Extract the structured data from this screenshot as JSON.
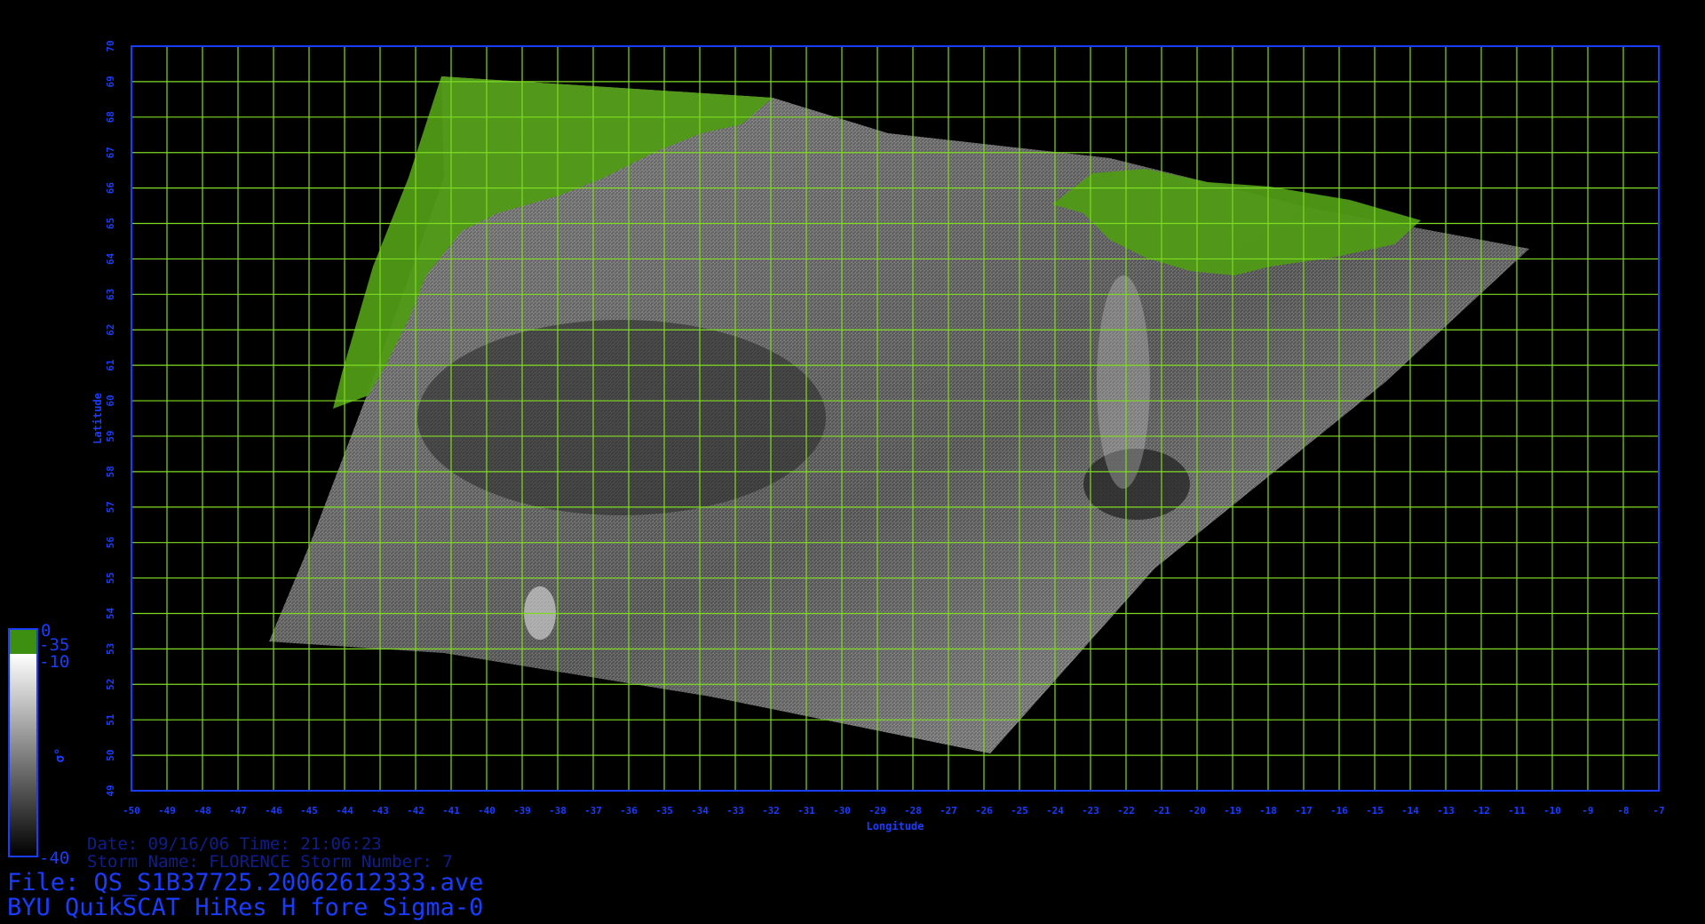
{
  "map": {
    "x_label": "Longitude",
    "y_label": "Latitude",
    "lon_range": [
      -50,
      -7
    ],
    "lat_range": [
      49,
      70
    ],
    "lon_ticks": [
      "-50",
      "-49",
      "-48",
      "-47",
      "-46",
      "-45",
      "-44",
      "-43",
      "-42",
      "-41",
      "-40",
      "-39",
      "-38",
      "-37",
      "-36",
      "-35",
      "-34",
      "-33",
      "-32",
      "-31",
      "-30",
      "-29",
      "-28",
      "-27",
      "-26",
      "-25",
      "-24",
      "-23",
      "-22",
      "-21",
      "-20",
      "-19",
      "-18",
      "-17",
      "-16",
      "-15",
      "-14",
      "-13",
      "-12",
      "-11",
      "-10",
      "-9",
      "-8",
      "-7"
    ],
    "lat_ticks": [
      "49",
      "50",
      "51",
      "52",
      "53",
      "54",
      "55",
      "56",
      "57",
      "58",
      "59",
      "60",
      "61",
      "62",
      "63",
      "64",
      "65",
      "66",
      "67",
      "68",
      "69",
      "70"
    ],
    "grid": true,
    "colors": {
      "frame": "#1a3cff",
      "grid": "#7fdc22",
      "land": "#4f9a16",
      "label": "#1a3cff",
      "ocean_light": "#9a9a9a",
      "ocean_dark": "#2e2e2e"
    }
  },
  "colorbar": {
    "symbol": "σ°",
    "labels": [
      "0",
      "-35",
      "-10",
      "-40"
    ],
    "colors": [
      "#3c8f10",
      "#ffffff",
      "#000000"
    ]
  },
  "footer": {
    "date_line": "Date: 09/16/06   Time: 21:06:23",
    "storm_line": "Storm Name: FLORENCE   Storm Number: 7",
    "file_line": "File: QS_S1B37725.20062612333.ave",
    "title_line": "BYU QuikSCAT HiRes H fore Sigma-0"
  }
}
